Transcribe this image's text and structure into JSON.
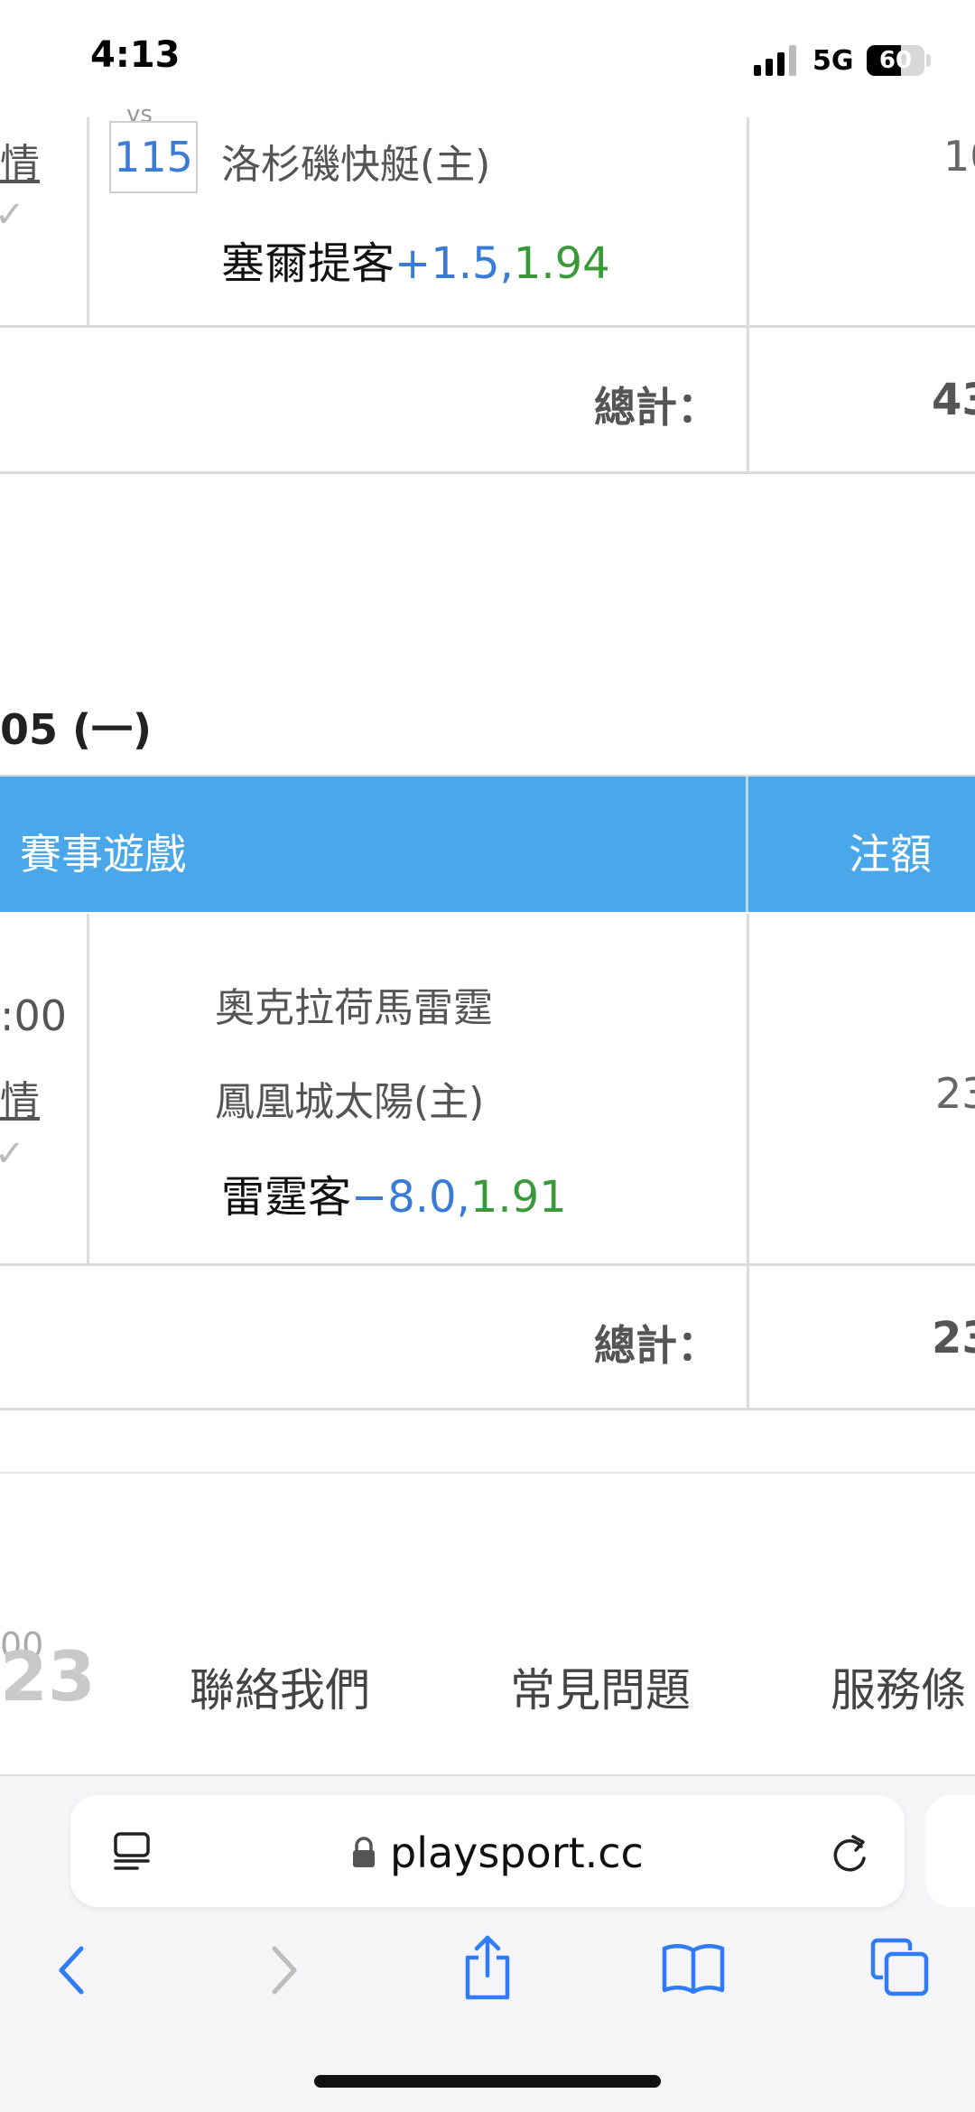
{
  "status": {
    "time": "4:13",
    "network": "5G",
    "battery": "60",
    "battery_level": 0.6
  },
  "top_section": {
    "link_partial": "情",
    "vs_partial": "vs",
    "game_number": "115",
    "home_team": "洛杉磯快艇(主)",
    "pick_team": "塞爾提客",
    "pick_line": "+1.5,",
    "pick_odds": "1.94",
    "amount_partial": "10",
    "total_label": "總計：",
    "total_value_partial": "43"
  },
  "date_section": {
    "date_partial": "05 (一)",
    "header_game": "賽事遊戲",
    "header_amount": "注額"
  },
  "game_row": {
    "time_partial": ":00",
    "link_partial": "情",
    "away_team": "奧克拉荷馬雷霆",
    "home_team": "鳳凰城太陽(主)",
    "pick_team": "雷霆客",
    "pick_line": "−8.0,",
    "pick_odds": "1.91",
    "amount_partial": "23",
    "total_label": "總計：",
    "total_value_partial": "23"
  },
  "footer": {
    "time_partial": "00",
    "big_partial": "23",
    "contact": "聯絡我們",
    "faq": "常見問題",
    "terms_partial": "服務條"
  },
  "browser": {
    "url": "playsport.cc",
    "icons": [
      "reader-icon",
      "lock-icon",
      "reload-icon",
      "back-icon",
      "forward-icon",
      "share-icon",
      "bookmarks-icon",
      "tabs-icon"
    ]
  }
}
